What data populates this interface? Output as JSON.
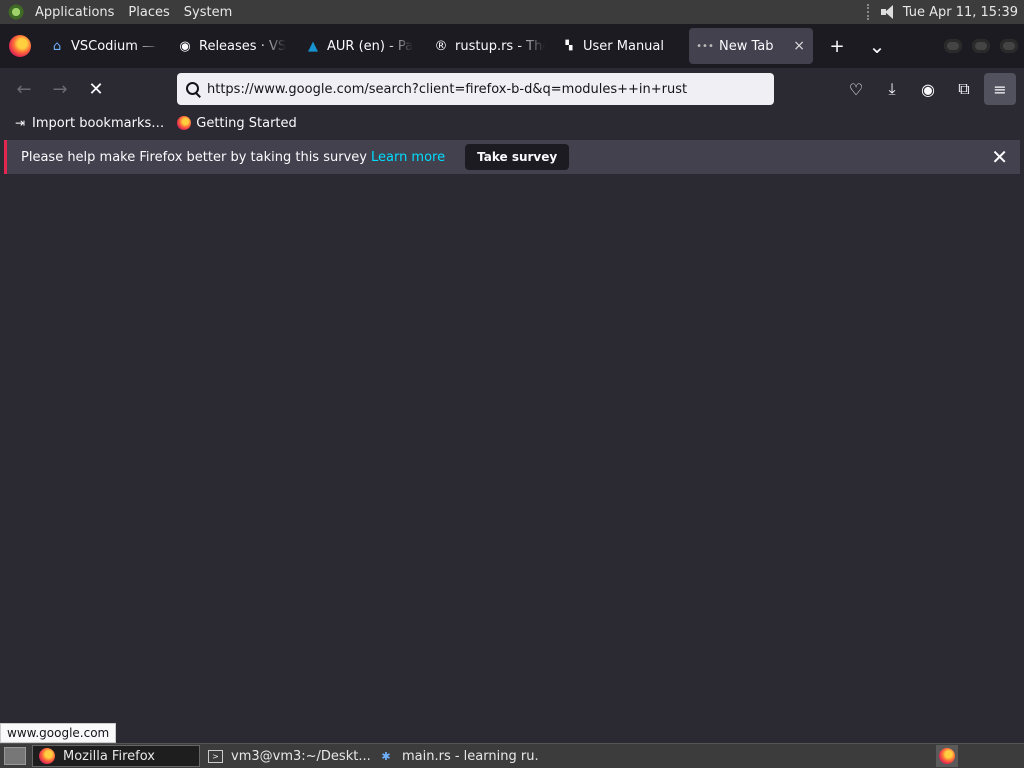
{
  "topbar": {
    "menus": [
      "Applications",
      "Places",
      "System"
    ],
    "clock": "Tue Apr 11, 15:39"
  },
  "tabs": [
    {
      "label": "VSCodium — L",
      "icon": "vscodium-icon"
    },
    {
      "label": "Releases · VS",
      "icon": "github-icon"
    },
    {
      "label": "AUR (en) - Pa",
      "icon": "arch-icon"
    },
    {
      "label": "rustup.rs - The",
      "icon": "rust-icon"
    },
    {
      "label": "User Manual",
      "icon": "manual-icon"
    },
    {
      "label": "New Tab",
      "icon": "loading-icon",
      "active": true
    }
  ],
  "tabbar": {
    "new_tab": "+",
    "list_all": "⌄",
    "close": "×"
  },
  "navbar": {
    "url": "https://www.google.com/search?client=firefox-b-d&q=modules++in+rust"
  },
  "bookmarks": [
    {
      "label": "Import bookmarks…",
      "icon": "import-icon"
    },
    {
      "label": "Getting Started",
      "icon": "firefox-icon"
    }
  ],
  "notice": {
    "text": "Please help make Firefox better by taking this survey",
    "link": "Learn more",
    "button": "Take survey"
  },
  "status_url": "www.google.com",
  "taskbar": {
    "tasks": [
      {
        "label": "Mozilla Firefox",
        "active": true
      },
      {
        "label": "vm3@vm3:~/Deskt..."
      },
      {
        "label": "main.rs - learning ru..."
      }
    ]
  },
  "colors": {
    "accent": "#00ddff",
    "chrome_bg": "#2b2a33",
    "tabbar_bg": "#1c1b22"
  }
}
